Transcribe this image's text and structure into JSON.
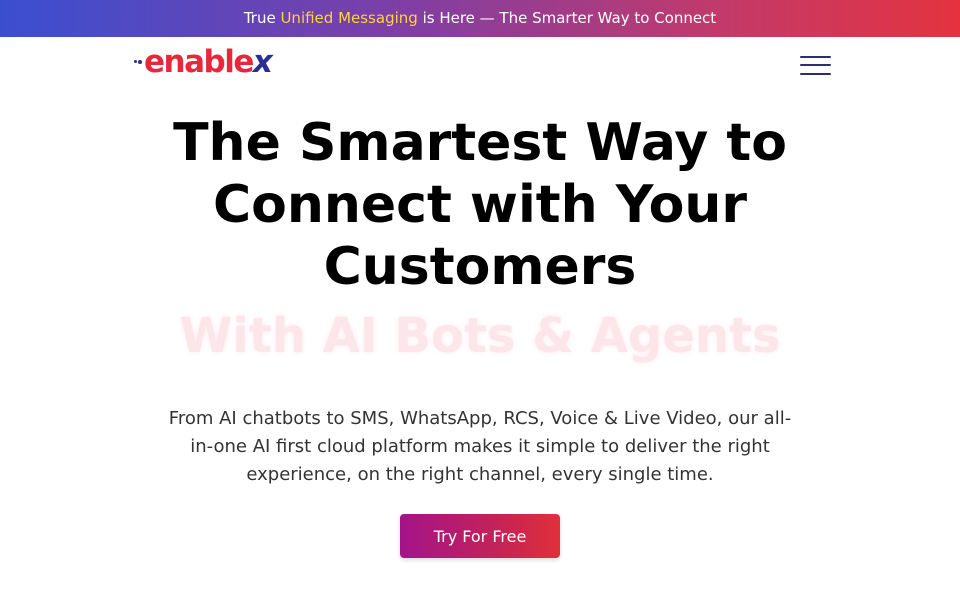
{
  "announcement": {
    "prefix": "True ",
    "highlight": "Unified Messaging",
    "suffix": " is Here — The Smarter Way to Connect"
  },
  "nav": {
    "logo_main": "enable",
    "logo_x": "x",
    "menu_icon": "hamburger-menu-icon"
  },
  "hero": {
    "title_line1": "The Smartest Way to",
    "title_line2": "Connect with Your",
    "title_line3": "Customers",
    "subtitle": "With AI Bots & Agents",
    "description": "From AI chatbots to SMS, WhatsApp, RCS, Voice & Live Video, our all-in-one AI first cloud platform makes it simple to deliver the right experience, on the right channel, every single time.",
    "cta_label": "Try For Free"
  },
  "colors": {
    "brand_red": "#e6283a",
    "brand_navy": "#2b2f8f",
    "highlight_yellow": "#ffd23a",
    "cta_gradient_start": "#a3148a",
    "cta_gradient_end": "#e0303a"
  }
}
